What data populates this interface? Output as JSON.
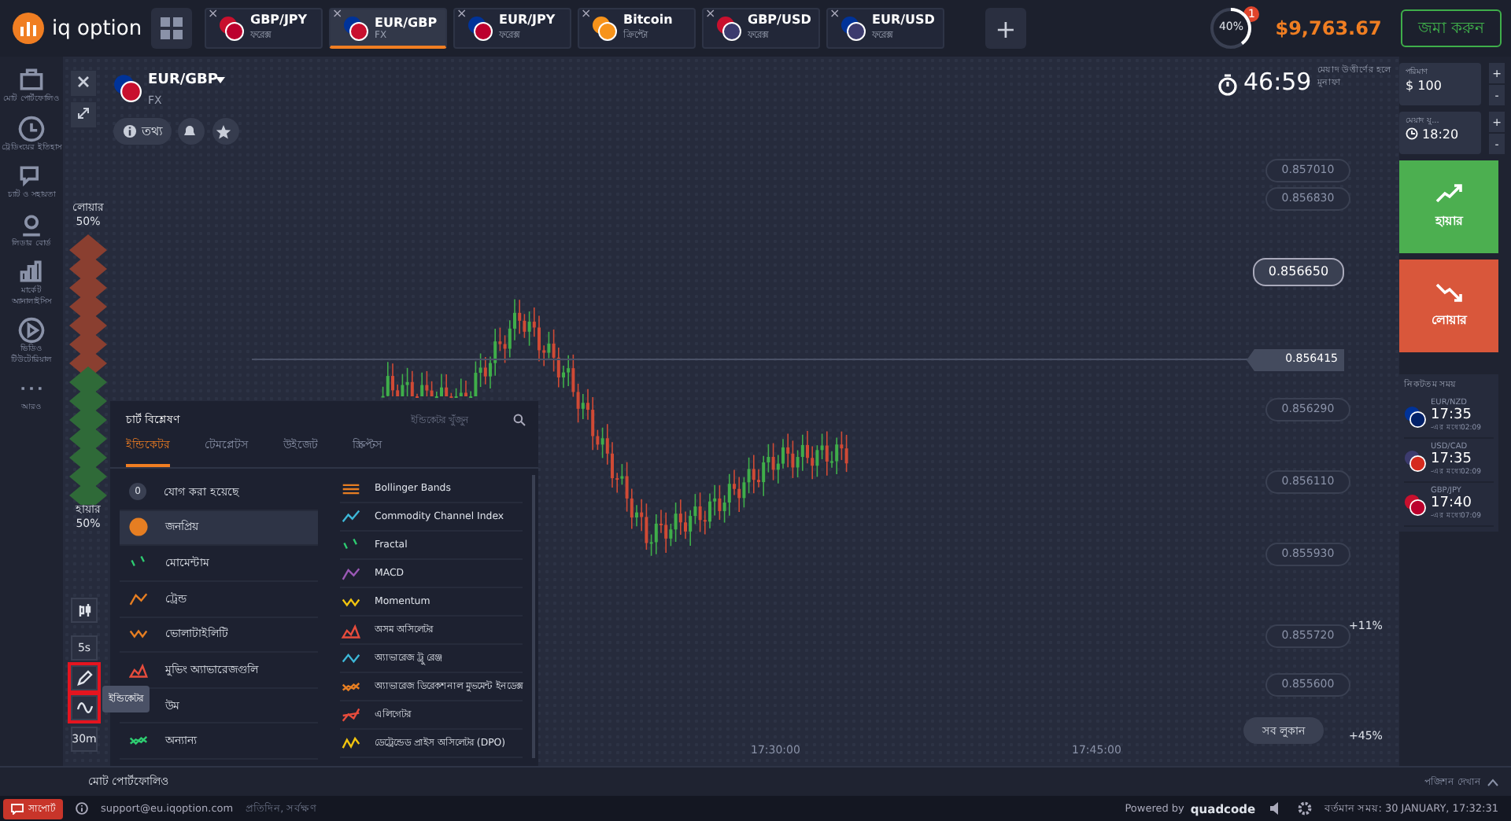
{
  "logo": {
    "text": "iq option"
  },
  "asset_tabs": [
    {
      "name": "GBP/JPY",
      "sub": "ফরেক্স",
      "close": "×",
      "selected": false
    },
    {
      "name": "EUR/GBP",
      "sub": "FX",
      "close": "×",
      "selected": true
    },
    {
      "name": "EUR/JPY",
      "sub": "ফরেক্স",
      "close": "×",
      "selected": false
    },
    {
      "name": "Bitcoin",
      "sub": "ক্রিপ্টো",
      "close": "×",
      "selected": false
    },
    {
      "name": "GBP/USD",
      "sub": "ফরেক্স",
      "close": "×",
      "selected": false
    },
    {
      "name": "EUR/USD",
      "sub": "ফরেক্স",
      "close": "×",
      "selected": false
    }
  ],
  "add_tab": "+",
  "progress": {
    "label": "40%",
    "level": 0.4,
    "badge": "1"
  },
  "balance": "$9,763.67",
  "deposit_button": "জমা করুন",
  "sidebar": {
    "items": [
      {
        "label": "মোট পোর্টফোলিও"
      },
      {
        "label": "ট্রেডিংয়ের ইতিহাস"
      },
      {
        "label": "চ্যাট ও সহায়তা"
      },
      {
        "label": "লিডার বোর্ড"
      },
      {
        "label": "মার্কেট অ্যানালাইসিস"
      },
      {
        "label": "ভিডিও টিউটোরিয়াল"
      },
      {
        "label": "আরও"
      }
    ]
  },
  "chart": {
    "asset": "EUR/GBP",
    "market": "FX",
    "info_button": "তথ্য",
    "timer": "46:59",
    "timer_note": "মেয়াদ উত্তীর্ণের হলে মুনাফা",
    "sentiment": {
      "lower_label": "লোয়ার",
      "lower_value": "50%",
      "higher_label": "হায়ার",
      "higher_value": "50%"
    },
    "price_levels": [
      {
        "value": "0.857010",
        "kind": "grid"
      },
      {
        "value": "0.856830",
        "kind": "grid"
      },
      {
        "value": "0.856650",
        "kind": "hover"
      },
      {
        "value": "0.856415",
        "kind": "current"
      },
      {
        "value": "0.856290",
        "kind": "grid"
      },
      {
        "value": "0.856110",
        "kind": "grid"
      },
      {
        "value": "0.855930",
        "kind": "grid"
      },
      {
        "value": "0.855720",
        "kind": "grid"
      },
      {
        "value": "0.855600",
        "kind": "grid"
      }
    ],
    "time_ticks": [
      "17:30:00",
      "17:45:00"
    ],
    "upper_percent": "+11%",
    "lower_percent": "+45%",
    "hide_all_button": "সব লুকান",
    "tools": [
      {
        "kind": "icon",
        "highlighted": false
      },
      {
        "kind": "text",
        "label": "5s",
        "highlighted": false
      },
      {
        "kind": "icon",
        "highlighted": true
      },
      {
        "kind": "icon",
        "highlighted": true
      },
      {
        "kind": "text",
        "label": "30m",
        "highlighted": false
      }
    ],
    "tooltip": "ইন্ডিকেটর"
  },
  "indicator_panel": {
    "title": "চার্ট বিশ্লেষণ",
    "search_placeholder": "ইন্ডিকেটর খুঁজুন",
    "tabs": [
      {
        "label": "ইন্ডিকেটর",
        "selected": true
      },
      {
        "label": "টেমপ্লেটস",
        "selected": false
      },
      {
        "label": "উইজেট",
        "selected": false
      },
      {
        "label": "স্ক্রিপ্টস",
        "selected": false
      }
    ],
    "categories": [
      {
        "kind": "count",
        "count": "0",
        "label": "যোগ করা হয়েছে",
        "selected": false
      },
      {
        "kind": "icon",
        "label": "জনপ্রিয়",
        "selected": true
      },
      {
        "kind": "icon",
        "label": "মোমেন্টাম",
        "selected": false
      },
      {
        "kind": "icon",
        "label": "ট্রেন্ড",
        "selected": false
      },
      {
        "kind": "icon",
        "label": "ভোলাটাইলিটি",
        "selected": false
      },
      {
        "kind": "icon",
        "label": "মুভিং অ্যাভারেজগুলি",
        "selected": false
      },
      {
        "kind": "plain",
        "label": "উম",
        "selected": false
      },
      {
        "kind": "icon",
        "label": "অন্যান্য",
        "selected": false
      }
    ],
    "indicators": [
      {
        "label": "Bollinger Bands"
      },
      {
        "label": "Commodity Channel Index"
      },
      {
        "label": "Fractal"
      },
      {
        "label": "MACD"
      },
      {
        "label": "Momentum"
      },
      {
        "label": "অসম অসিলেটর"
      },
      {
        "label": "অ্যাভারেজ ট্রু রেঞ্জ"
      },
      {
        "label": "অ্যাভারেজ ডিরেকশনাল মুভমেন্ট ইনডেক্স"
      },
      {
        "label": "এলিগেটর"
      },
      {
        "label": "ডেট্রেন্ডেড প্রাইস অসিলেটর (DPO)"
      }
    ]
  },
  "trade_panel": {
    "amount": {
      "label": "পরিমাণ",
      "value": "$ 100",
      "plus": "+",
      "minus": "-"
    },
    "expiry": {
      "label": "মেয়াদ যু...",
      "value": "18:20",
      "plus": "+",
      "minus": "-"
    },
    "higher_button": "হায়ার",
    "lower_button": "লোয়ার",
    "expirations": {
      "title": "নিকটতম সময়",
      "items": [
        {
          "pair": "EUR/NZD",
          "time": "17:35",
          "remaining": "-এর মধ্যে02:09"
        },
        {
          "pair": "USD/CAD",
          "time": "17:35",
          "remaining": "-এর মধ্যে02:09"
        },
        {
          "pair": "GBP/JPY",
          "time": "17:40",
          "remaining": "-এর মধ্যে07:09"
        }
      ]
    }
  },
  "bottom_bar": {
    "portfolio": "মোট পোর্টফোলিও",
    "show_positions": "পজিশন দেখান"
  },
  "status_bar": {
    "support_button": "সাপোর্ট",
    "email": "support@eu.iqoption.com",
    "hours": "প্রতিদিন, সর্বক্ষণ",
    "powered": "Powered by",
    "brand": "quadcode",
    "time": "বর্তমান সময়: 30 JANUARY, 17:32:31"
  }
}
